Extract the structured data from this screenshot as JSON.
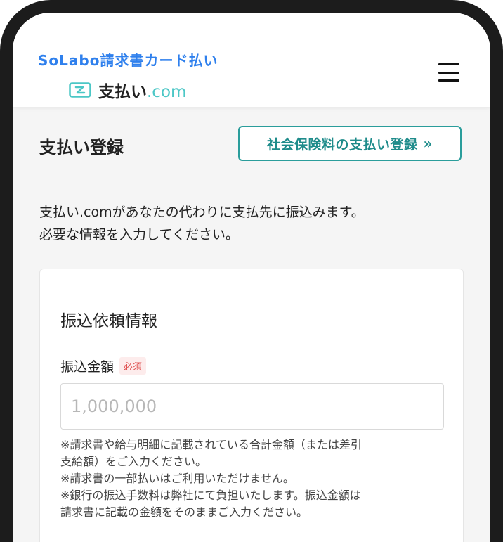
{
  "header": {
    "brand_title": "SoLabo請求書カード払い",
    "logo_main": "支払い",
    "logo_suffix": ".com",
    "menu_icon": "hamburger-icon"
  },
  "page": {
    "title": "支払い登録",
    "social_button_label": "社会保険料の支払い登録",
    "social_button_icon": "»",
    "intro_line1": "支払い.comがあなたの代わりに支払先に振込みます。",
    "intro_line2": "必要な情報を入力してください。"
  },
  "form": {
    "section_title": "振込依頼情報",
    "amount_label": "振込金額",
    "required_badge": "必須",
    "amount_placeholder": "1,000,000",
    "amount_value": "",
    "notes": [
      "※請求書や給与明細に記載されている合計金額（または差引",
      "支給額）をご入力ください。",
      "※請求書の一部払いはご利用いただけません。",
      "※銀行の振込手数料は弊社にて負担いたします。振込金額は",
      "請求書に記載の金額をそのままご入力ください。"
    ]
  },
  "colors": {
    "brand_blue": "#2f80ed",
    "teal": "#2a9d9b",
    "logo_teal": "#4cc7c6",
    "required_red": "#e05454"
  }
}
